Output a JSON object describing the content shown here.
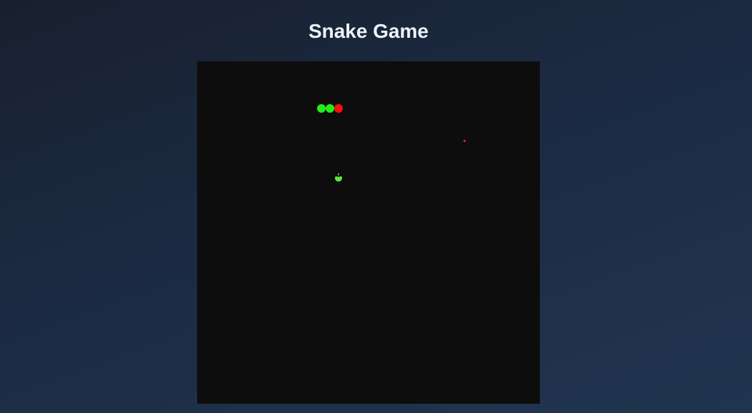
{
  "page": {
    "title": "Snake Game"
  },
  "game": {
    "board": {
      "background": "#0d0d0d",
      "cell_size": 12
    },
    "snake": {
      "head_color": "#ff1010",
      "body_color": "#22ee1a",
      "segments": [
        {
          "role": "body",
          "col": 14,
          "row": 5
        },
        {
          "role": "body",
          "col": 15,
          "row": 5
        },
        {
          "role": "head",
          "col": 16,
          "row": 5
        }
      ]
    },
    "food": {
      "icon": "apple-icon",
      "color": "#5ee83a",
      "stem_color": "#e0a020",
      "col": 16,
      "row": 13
    },
    "projectile": {
      "color": "#ff2020",
      "col": 31,
      "row": 9
    }
  }
}
